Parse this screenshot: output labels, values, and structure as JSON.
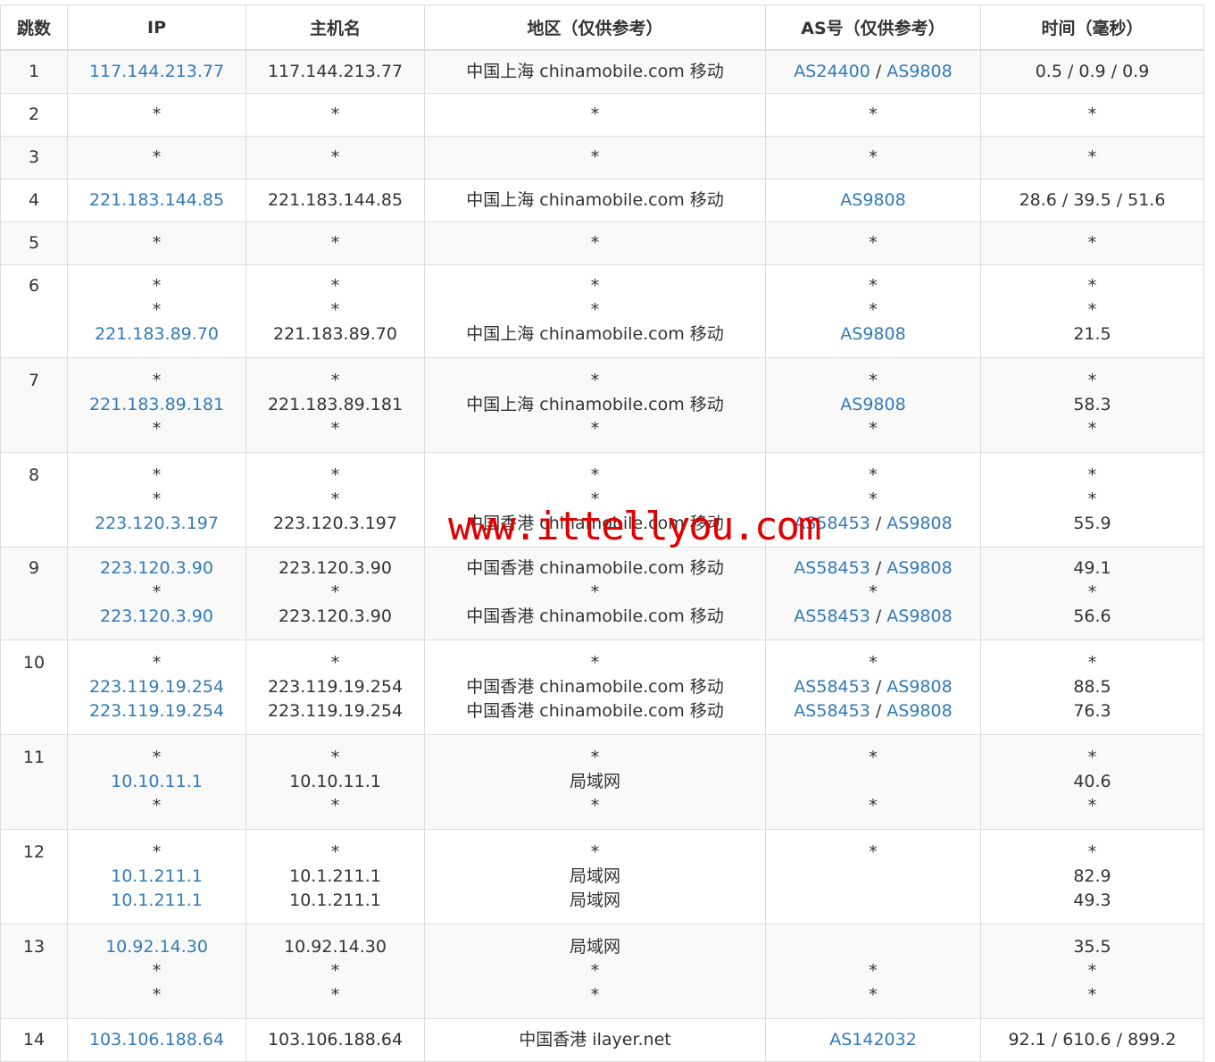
{
  "headers": [
    "跳数",
    "IP",
    "主机名",
    "地区（仅供参考）",
    "AS号（仅供参考）",
    "时间（毫秒）"
  ],
  "watermark": "www.ittellyou.com",
  "rows": [
    {
      "hop": "1",
      "pt": 10,
      "pb": 10,
      "lines": [
        {
          "ip": "117.144.213.77",
          "host": "117.144.213.77",
          "region": "中国上海 chinamobile.com 移动",
          "as": [
            "AS24400",
            "AS9808"
          ],
          "time": "0.5 / 0.9 / 0.9"
        }
      ]
    },
    {
      "hop": "2",
      "pt": 10,
      "pb": 10,
      "lines": [
        {
          "ip": "*",
          "host": "*",
          "region": "*",
          "as": [
            "*"
          ],
          "time": "*"
        }
      ]
    },
    {
      "hop": "3",
      "pt": 10,
      "pb": 10,
      "lines": [
        {
          "ip": "*",
          "host": "*",
          "region": "*",
          "as": [
            "*"
          ],
          "time": "*"
        }
      ]
    },
    {
      "hop": "4",
      "pt": 10,
      "pb": 10,
      "lines": [
        {
          "ip": "221.183.144.85",
          "host": "221.183.144.85",
          "region": "中国上海 chinamobile.com 移动",
          "as": [
            "AS9808"
          ],
          "time": "28.6 / 39.5 / 51.6"
        }
      ]
    },
    {
      "hop": "5",
      "pt": 10,
      "pb": 10,
      "lines": [
        {
          "ip": "*",
          "host": "*",
          "region": "*",
          "as": [
            "*"
          ],
          "time": "*"
        }
      ]
    },
    {
      "hop": "6",
      "pt": 10,
      "pb": 12,
      "lines": [
        {
          "ip": "*",
          "host": "*",
          "region": "*",
          "as": [
            "*"
          ],
          "time": "*"
        },
        {
          "ip": "*",
          "host": "*",
          "region": "*",
          "as": [
            "*"
          ],
          "time": "*"
        },
        {
          "ip": "221.183.89.70",
          "host": "221.183.89.70",
          "region": "中国上海 chinamobile.com 移动",
          "as": [
            "AS9808"
          ],
          "time": "21.5"
        }
      ]
    },
    {
      "hop": "7",
      "pt": 12,
      "pb": 12,
      "lines": [
        {
          "ip": "*",
          "host": "*",
          "region": "*",
          "as": [
            "*"
          ],
          "time": "*"
        },
        {
          "ip": "221.183.89.181",
          "host": "221.183.89.181",
          "region": "中国上海 chinamobile.com 移动",
          "as": [
            "AS9808"
          ],
          "time": "58.3"
        },
        {
          "ip": "*",
          "host": "*",
          "region": "*",
          "as": [
            "*"
          ],
          "time": "*"
        }
      ]
    },
    {
      "hop": "8",
      "pt": 12,
      "pb": 12,
      "lines": [
        {
          "ip": "*",
          "host": "*",
          "region": "*",
          "as": [
            "*"
          ],
          "time": "*"
        },
        {
          "ip": "*",
          "host": "*",
          "region": "*",
          "as": [
            "*"
          ],
          "time": "*"
        },
        {
          "ip": "223.120.3.197",
          "host": "223.120.3.197",
          "region": "中国香港 chinamobile.com 移动",
          "as": [
            "AS58453",
            "AS9808"
          ],
          "time": "55.9"
        }
      ]
    },
    {
      "hop": "9",
      "pt": 10,
      "pb": 12,
      "lines": [
        {
          "ip": "223.120.3.90",
          "host": "223.120.3.90",
          "region": "中国香港 chinamobile.com 移动",
          "as": [
            "AS58453",
            "AS9808"
          ],
          "time": "49.1"
        },
        {
          "ip": "*",
          "host": "*",
          "region": "*",
          "as": [
            "*"
          ],
          "time": "*"
        },
        {
          "ip": "223.120.3.90",
          "host": "223.120.3.90",
          "region": "中国香港 chinamobile.com 移动",
          "as": [
            "AS58453",
            "AS9808"
          ],
          "time": "56.6"
        }
      ]
    },
    {
      "hop": "10",
      "pt": 12,
      "pb": 12,
      "lines": [
        {
          "ip": "*",
          "host": "*",
          "region": "*",
          "as": [
            "*"
          ],
          "time": "*"
        },
        {
          "ip": "223.119.19.254",
          "host": "223.119.19.254",
          "region": "中国香港 chinamobile.com 移动",
          "as": [
            "AS58453",
            "AS9808"
          ],
          "time": "88.5"
        },
        {
          "ip": "223.119.19.254",
          "host": "223.119.19.254",
          "region": "中国香港 chinamobile.com 移动",
          "as": [
            "AS58453",
            "AS9808"
          ],
          "time": "76.3"
        }
      ]
    },
    {
      "hop": "11",
      "pt": 12,
      "pb": 12,
      "lines": [
        {
          "ip": "*",
          "host": "*",
          "region": "*",
          "as": [
            "*"
          ],
          "time": "*"
        },
        {
          "ip": "10.10.11.1",
          "host": "10.10.11.1",
          "region": "局域网",
          "as": [],
          "time": "40.6"
        },
        {
          "ip": "*",
          "host": "*",
          "region": "*",
          "as": [
            "*"
          ],
          "time": "*"
        }
      ]
    },
    {
      "hop": "12",
      "pt": 12,
      "pb": 12,
      "lines": [
        {
          "ip": "*",
          "host": "*",
          "region": "*",
          "as": [
            "*"
          ],
          "time": "*"
        },
        {
          "ip": "10.1.211.1",
          "host": "10.1.211.1",
          "region": "局域网",
          "as": [],
          "time": "82.9"
        },
        {
          "ip": "10.1.211.1",
          "host": "10.1.211.1",
          "region": "局域网",
          "as": [],
          "time": "49.3"
        }
      ]
    },
    {
      "hop": "13",
      "pt": 12,
      "pb": 12,
      "lines": [
        {
          "ip": "10.92.14.30",
          "host": "10.92.14.30",
          "region": "局域网",
          "as": [],
          "time": "35.5"
        },
        {
          "ip": "*",
          "host": "*",
          "region": "*",
          "as": [
            "*"
          ],
          "time": "*"
        },
        {
          "ip": "*",
          "host": "*",
          "region": "*",
          "as": [
            "*"
          ],
          "time": "*"
        }
      ]
    },
    {
      "hop": "14",
      "pt": 10,
      "pb": 10,
      "lines": [
        {
          "ip": "103.106.188.64",
          "host": "103.106.188.64",
          "region": "中国香港 ilayer.net",
          "as": [
            "AS142032"
          ],
          "time": "92.1 / 610.6 / 899.2"
        }
      ]
    }
  ]
}
